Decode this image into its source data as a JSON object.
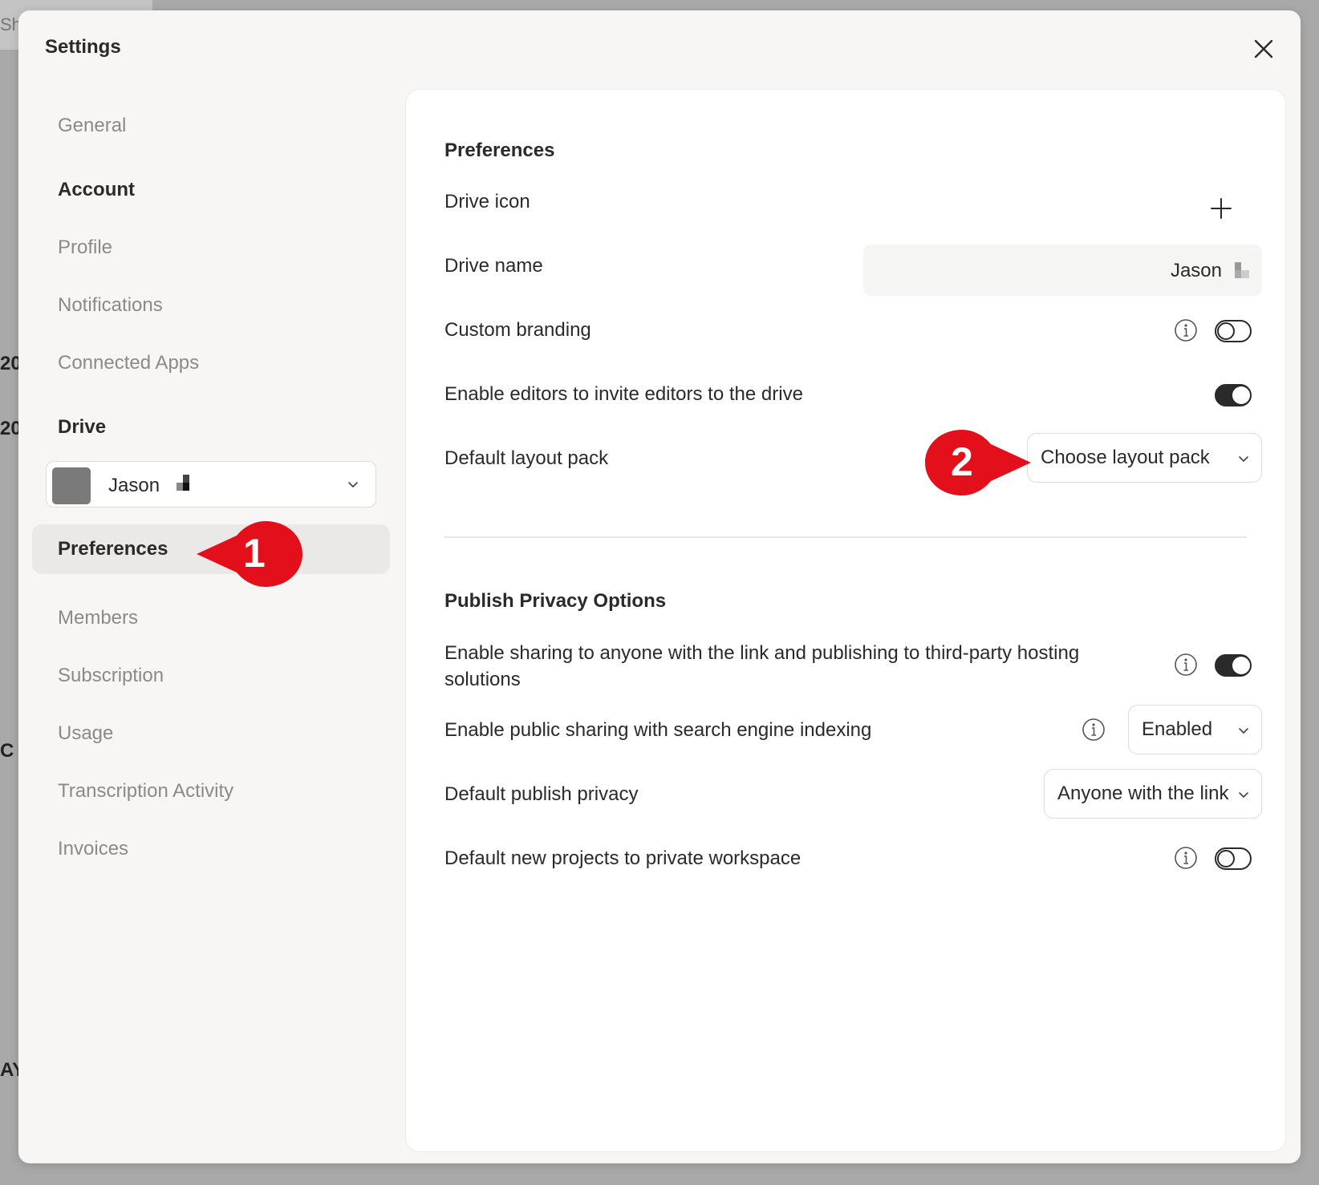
{
  "background": {
    "fragments": [
      "Sha",
      "20",
      "20",
      "C",
      "AY"
    ]
  },
  "dialog": {
    "title": "Settings"
  },
  "sidebar": {
    "general": "General",
    "account_heading": "Account",
    "profile": "Profile",
    "notifications": "Notifications",
    "connected_apps": "Connected Apps",
    "drive_heading": "Drive",
    "drive_select_name": "Jason",
    "preferences": "Preferences",
    "members": "Members",
    "subscription": "Subscription",
    "usage": "Usage",
    "transcription_activity": "Transcription Activity",
    "invoices": "Invoices"
  },
  "preferences": {
    "title": "Preferences",
    "drive_icon_label": "Drive icon",
    "drive_name_label": "Drive name",
    "drive_name_value": "Jason",
    "custom_branding_label": "Custom branding",
    "custom_branding_enabled": false,
    "invite_editors_label": "Enable editors to invite editors to the drive",
    "invite_editors_enabled": true,
    "layout_pack_label": "Default layout pack",
    "layout_pack_value": "Choose layout pack"
  },
  "privacy": {
    "title": "Publish Privacy Options",
    "share_link_label": "Enable sharing to anyone with the link and publishing to third-party hosting solutions",
    "share_link_enabled": true,
    "indexing_label": "Enable public sharing with search engine indexing",
    "indexing_value": "Enabled",
    "publish_privacy_label": "Default publish privacy",
    "publish_privacy_value": "Anyone with the link",
    "private_workspace_label": "Default new projects to private workspace",
    "private_workspace_enabled": false
  },
  "annotations": {
    "marker1": "1",
    "marker2": "2",
    "color": "#e3101b"
  }
}
